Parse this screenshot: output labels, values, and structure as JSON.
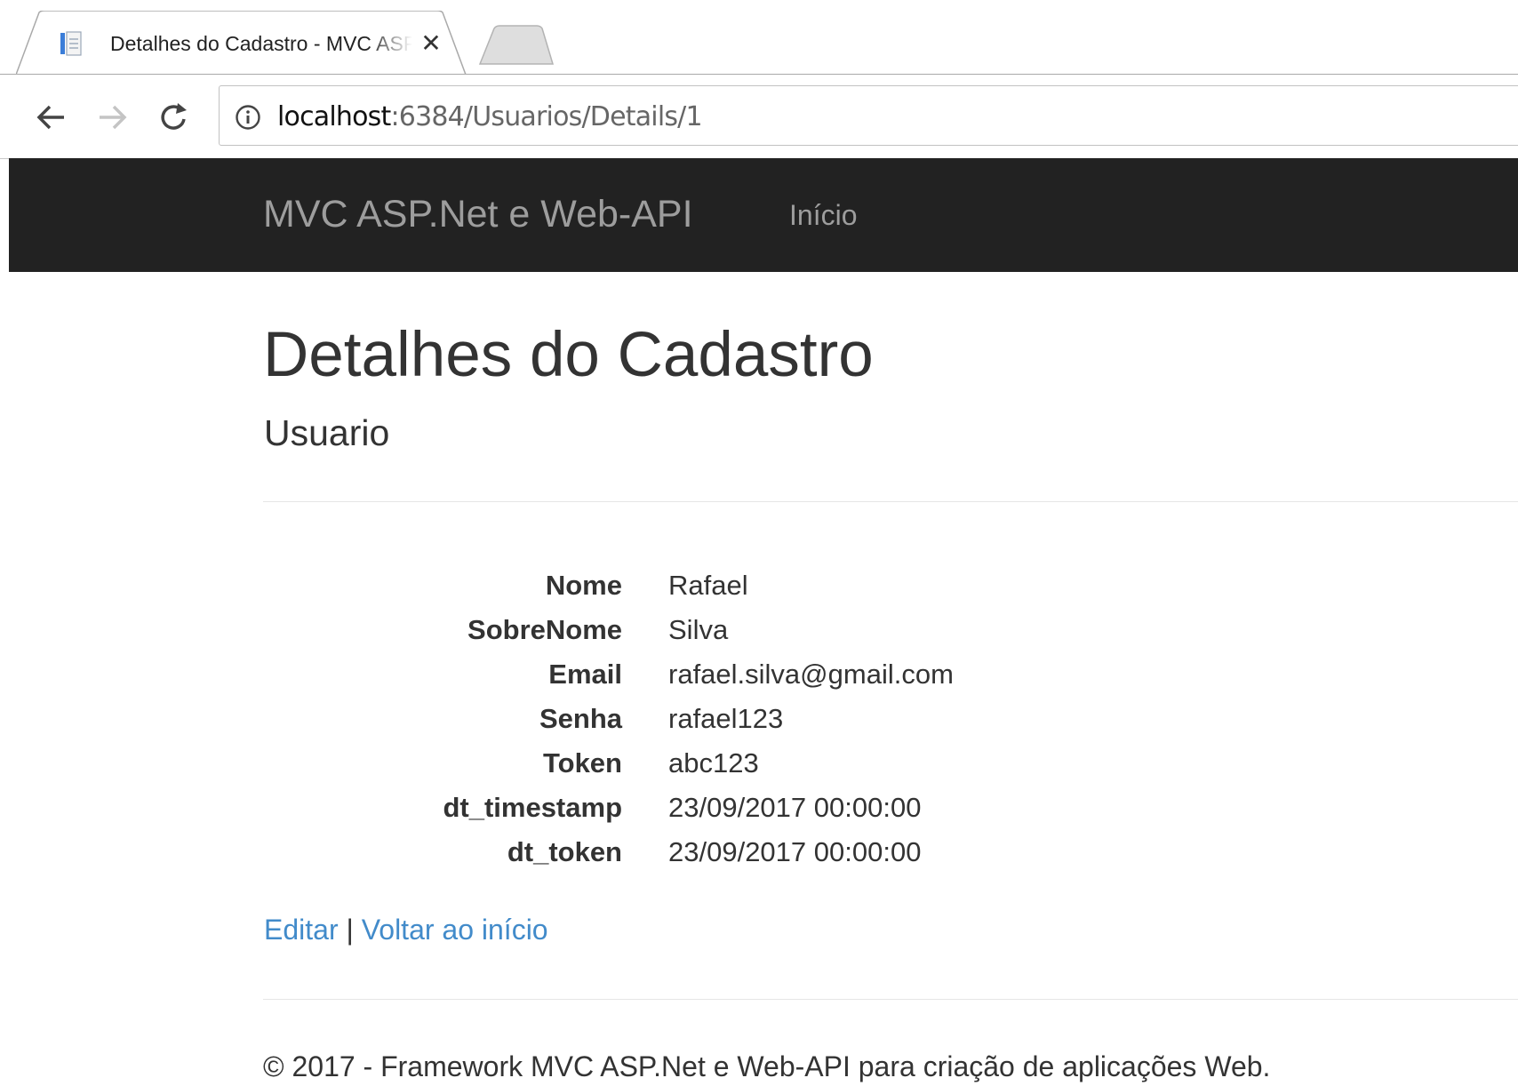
{
  "browser": {
    "tab": {
      "title": "Detalhes do Cadastro - MVC ASP.Net e Web-API",
      "close_glyph": "✕"
    },
    "toolbar": {
      "back_icon": "arrow-left-icon",
      "forward_icon": "arrow-right-icon",
      "reload_icon": "reload-icon",
      "info_icon": "info-icon"
    },
    "url": {
      "host": "localhost",
      "rest": ":6384/Usuarios/Details/1"
    }
  },
  "navbar": {
    "brand": "MVC ASP.Net e Web-API",
    "links": [
      "Início"
    ],
    "background": "#222222",
    "text_color": "#9d9d9d"
  },
  "page": {
    "title": "Detalhes do Cadastro",
    "subtitle": "Usuario",
    "fields": [
      {
        "label": "Nome",
        "value": "Rafael"
      },
      {
        "label": "SobreNome",
        "value": "Silva"
      },
      {
        "label": "Email",
        "value": "rafael.silva@gmail.com"
      },
      {
        "label": "Senha",
        "value": "rafael123"
      },
      {
        "label": "Token",
        "value": "abc123"
      },
      {
        "label": "dt_timestamp",
        "value": "23/09/2017 00:00:00"
      },
      {
        "label": "dt_token",
        "value": "23/09/2017 00:00:00"
      }
    ],
    "actions": {
      "edit": "Editar",
      "separator": " | ",
      "back": "Voltar ao início"
    },
    "link_color": "#428bca"
  },
  "footer": {
    "text": "© 2017 - Framework MVC ASP.Net e Web-API para criação de aplicações Web."
  }
}
